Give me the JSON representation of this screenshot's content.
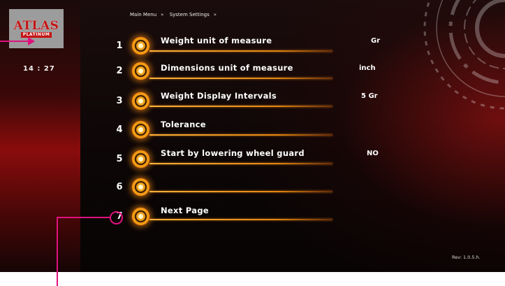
{
  "app": {
    "brand": "ATLAS",
    "brand_sub": "PLATINUM",
    "time": "14 : 27",
    "revision": "Rev: 1.0.5.h."
  },
  "breadcrumb": {
    "item1": "Main Menu",
    "sep": "»",
    "item2": "System Settings",
    "sep2": "»"
  },
  "menu": [
    {
      "number": "1",
      "label": "Weight unit of measure",
      "value": "Gr"
    },
    {
      "number": "2",
      "label": "Dimensions unit of measure",
      "value": "inch"
    },
    {
      "number": "3",
      "label": "Weight Display Intervals",
      "value": "5 Gr"
    },
    {
      "number": "4",
      "label": "Tolerance",
      "value": ""
    },
    {
      "number": "5",
      "label": "Start by lowering wheel guard",
      "value": "NO"
    },
    {
      "number": "6",
      "label": "",
      "value": ""
    },
    {
      "number": "7",
      "label": "Next Page",
      "value": ""
    }
  ],
  "colors": {
    "accent": "#f29a14",
    "annotation": "#e0117d",
    "brand_red": "#c41414"
  }
}
